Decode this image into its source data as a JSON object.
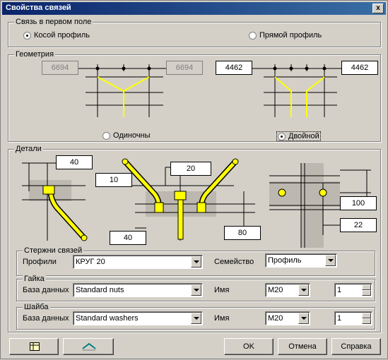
{
  "window": {
    "title": "Свойства связей",
    "close_glyph": "x"
  },
  "first_field": {
    "legend": "Связь в первом поле",
    "opt_skew": "Косой профиль",
    "opt_straight": "Прямой профиль",
    "selected": "skew"
  },
  "geometry": {
    "legend": "Геометрия",
    "single_left": "6694",
    "single_right": "6694",
    "double_left": "4462",
    "double_right": "4462",
    "opt_single": "Одиночны",
    "opt_double": "Двойной",
    "selected": "double"
  },
  "details": {
    "legend": "Детали",
    "val_40_top": "40",
    "val_10": "10",
    "val_20": "20",
    "val_40_bottom": "40",
    "val_80": "80",
    "val_100": "100",
    "val_22": "22"
  },
  "rods": {
    "legend": "Стержни связей",
    "profiles_label": "Профили",
    "profiles_value": "КРУГ 20",
    "family_label": "Семейство",
    "family_value": "Профиль"
  },
  "nut": {
    "legend": "Гайка",
    "db_label": "База данных",
    "db_value": "Standard nuts",
    "name_label": "Имя",
    "name_value": "M20",
    "qty": "1"
  },
  "washer": {
    "legend": "Шайба",
    "db_label": "База данных",
    "db_value": "Standard washers",
    "name_label": "Имя",
    "name_value": "M20",
    "qty": "1"
  },
  "buttons": {
    "ok": "OK",
    "cancel": "Отмена",
    "help": "Справка"
  },
  "colors": {
    "accent": "#ffff00",
    "title": "#0a246a"
  }
}
